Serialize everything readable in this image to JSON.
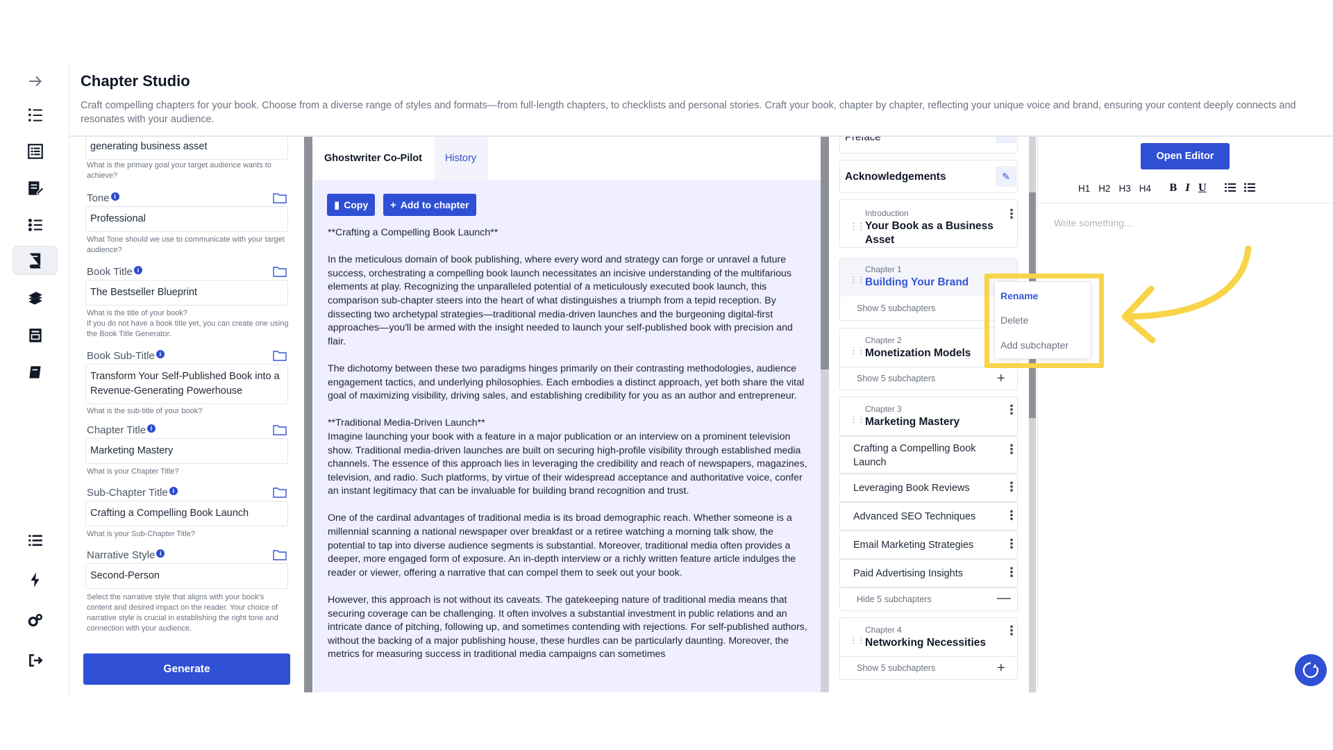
{
  "header": {
    "title": "Chapter Studio",
    "description": "Craft compelling chapters for your book. Choose from a diverse range of styles and formats—from full-length chapters, to checklists and personal stories. Craft your book, chapter by chapter, reflecting your unique voice and brand, ensuring your content deeply connects and resonates with your audience."
  },
  "sidebar": {
    "icons": [
      "arrow-right-icon",
      "numbered-list-icon",
      "document-list-icon",
      "edit-document-icon",
      "checklist-icon",
      "book-icon",
      "stacked-books-icon",
      "archive-book-icon",
      "notebook-icon",
      "menu-list-icon",
      "lightning-icon",
      "settings-gears-icon",
      "logout-icon"
    ],
    "active_index": 5
  },
  "form": {
    "goal_value": "generating business asset",
    "goal_hint": "What is the primary goal your target audience wants to achieve?",
    "tone_label": "Tone",
    "tone_value": "Professional",
    "tone_hint": "What Tone should we use to communicate with your target audience?",
    "book_title_label": "Book Title",
    "book_title_value": "The Bestseller Blueprint",
    "book_title_hint": "What is the title of your book?\nIf you do not have a book title yet, you can create one using the Book Title Generator.",
    "book_subtitle_label": "Book Sub-Title",
    "book_subtitle_value": "Transform Your Self-Published Book into a Revenue-Generating Powerhouse",
    "book_subtitle_hint": "What is the sub-title of your book?",
    "chapter_title_label": "Chapter Title",
    "chapter_title_value": "Marketing Mastery",
    "chapter_title_hint": "What is your Chapter Title?",
    "subchapter_title_label": "Sub-Chapter Title",
    "subchapter_title_value": "Crafting a Compelling Book Launch",
    "subchapter_title_hint": "What is your Sub-Chapter Title?",
    "narrative_label": "Narrative Style",
    "narrative_value": "Second-Person",
    "narrative_hint": "Select the narrative style that aligns with your book's content and desired impact on the reader. Your choice of narrative style is crucial in establishing the right tone and connection with your audience.",
    "generate_label": "Generate"
  },
  "ghostwriter": {
    "tab_copilot": "Ghostwriter Co-Pilot",
    "tab_history": "History",
    "copy_label": "Copy",
    "add_label": "Add to chapter",
    "paragraphs": [
      "**Crafting a Compelling Book Launch**",
      "In the meticulous domain of book publishing, where every word and strategy can forge or unravel a future success, orchestrating a compelling book launch necessitates an incisive understanding of the multifarious elements at play. Recognizing the unparalleled potential of a meticulously executed book launch, this comparison sub-chapter steers into the heart of what distinguishes a triumph from a tepid reception. By dissecting two archetypal strategies—traditional media-driven launches and the burgeoning digital-first approaches—you'll be armed with the insight needed to launch your self-published book with precision and flair.",
      "The dichotomy between these two paradigms hinges primarily on their contrasting methodologies, audience engagement tactics, and underlying philosophies. Each embodies a distinct approach, yet both share the vital goal of maximizing visibility, driving sales, and establishing credibility for you as an author and entrepreneur.",
      "**Traditional Media-Driven Launch**",
      "Imagine launching your book with a feature in a major publication or an interview on a prominent television show. Traditional media-driven launches are built on securing high-profile visibility through established media channels. The essence of this approach lies in leveraging the credibility and reach of newspapers, magazines, television, and radio. Such platforms, by virtue of their widespread acceptance and authoritative voice, confer an instant legitimacy that can be invaluable for building brand recognition and trust.",
      "One of the cardinal advantages of traditional media is its broad demographic reach. Whether someone is a millennial scanning a national newspaper over breakfast or a retiree watching a morning talk show, the potential to tap into diverse audience segments is substantial. Moreover, traditional media often provides a deeper, more engaged form of exposure. An in-depth interview or a richly written feature article indulges the reader or viewer, offering a narrative that can compel them to seek out your book.",
      "However, this approach is not without its caveats. The gatekeeping nature of traditional media means that securing coverage can be challenging. It often involves a substantial investment in public relations and an intricate dance of pitching, following up, and sometimes contending with rejections. For self-published authors, without the backing of a major publishing house, these hurdles can be particularly daunting. Moreover, the metrics for measuring success in traditional media campaigns can sometimes"
    ]
  },
  "chapters": {
    "preface_label": "Preface",
    "acknowledgements_label": "Acknowledgements",
    "introduction_small": "Introduction",
    "introduction_title": "Your Book as a Business Asset",
    "ch1_small": "Chapter 1",
    "ch1_title": "Building Your Brand",
    "ch1_toggle": "Show 5 subchapters",
    "ch2_small": "Chapter 2",
    "ch2_title": "Monetization Models",
    "ch2_toggle": "Show 5 subchapters",
    "ch3_small": "Chapter 3",
    "ch3_title": "Marketing Mastery",
    "ch3_subchapters": [
      "Crafting a Compelling Book Launch",
      "Leveraging Book Reviews",
      "Advanced SEO Techniques",
      "Email Marketing Strategies",
      "Paid Advertising Insights"
    ],
    "ch3_toggle": "Hide 5 subchapters",
    "ch4_small": "Chapter 4",
    "ch4_title": "Networking Necessities",
    "ch4_toggle": "Show 5 subchapters"
  },
  "context_menu": {
    "rename": "Rename",
    "delete": "Delete",
    "add_subchapter": "Add subchapter"
  },
  "editor": {
    "open_label": "Open Editor",
    "toolbar": [
      "H1",
      "H2",
      "H3",
      "H4",
      "B",
      "I",
      "U"
    ],
    "placeholder": "Write something..."
  },
  "colors": {
    "accent": "#2f4fd4",
    "highlight": "#f8d449",
    "ghost_bg": "#efefff"
  }
}
